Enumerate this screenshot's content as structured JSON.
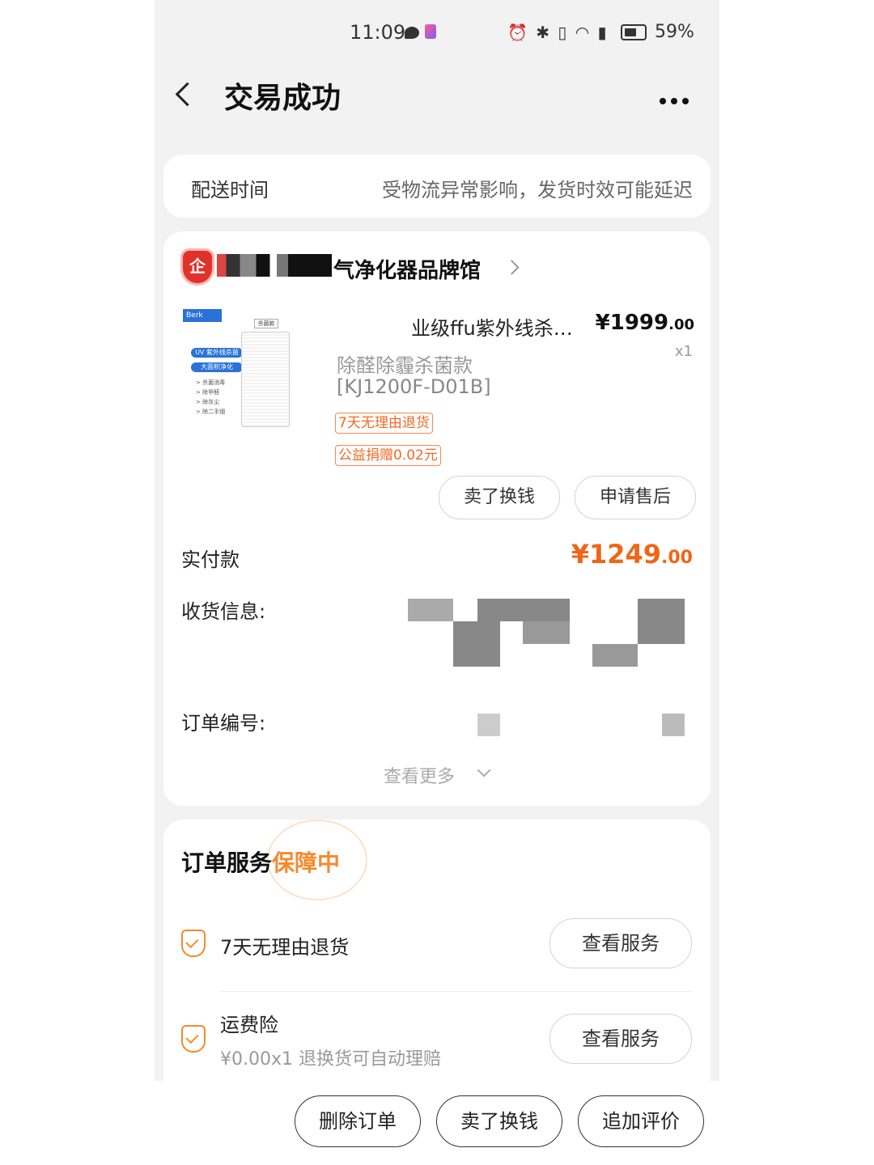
{
  "status_bar": {
    "time": "11:09",
    "battery": "59%",
    "icons": "⏰ ✱ ▯ ◠ ▮"
  },
  "header": {
    "title": "交易成功"
  },
  "delivery": {
    "label": "配送时间",
    "note": "受物流异常影响，发货时效可能延迟"
  },
  "shop": {
    "badge": "企",
    "name": "气净化器品牌馆"
  },
  "product": {
    "image_brand": "Berk",
    "image_tag": "杀菌款",
    "image_tag1": "UV 紫外线杀菌",
    "image_tag2": "大面积净化",
    "image_features": [
      "> 杀菌消毒",
      "> 除甲醛",
      "> 除灰尘",
      "> 除二手烟"
    ],
    "name": "业级ffu紫外线杀…",
    "price_int": "¥1999",
    "price_dec": ".00",
    "qty": "x1",
    "spec": "除醛除霾杀菌款",
    "model": "[KJ1200F-D01B]",
    "tag_return": "7天无理由退货",
    "tag_donation": "公益捐赠0.02元",
    "btn_sell": "卖了换钱",
    "btn_aftersale": "申请售后"
  },
  "order": {
    "paid_label": "实付款",
    "paid_int": "¥1249",
    "paid_dec": ".00",
    "shipping_label": "收货信息:",
    "order_no_label": "订单编号:",
    "view_more": "查看更多"
  },
  "service": {
    "title_prefix": "订单服务",
    "title_highlight": "保障中",
    "item1_name": "7天无理由退货",
    "item1_btn": "查看服务",
    "item2_name": "运费险",
    "item2_sub": "¥0.00x1  退换货可自动理赔",
    "item2_btn": "查看服务"
  },
  "bottom_bar": {
    "delete": "删除订单",
    "sell": "卖了换钱",
    "review": "追加评价"
  },
  "colors": {
    "accent_orange": "#ee6617",
    "shop_red": "#e0322a",
    "brand_blue": "#2a72d8"
  }
}
